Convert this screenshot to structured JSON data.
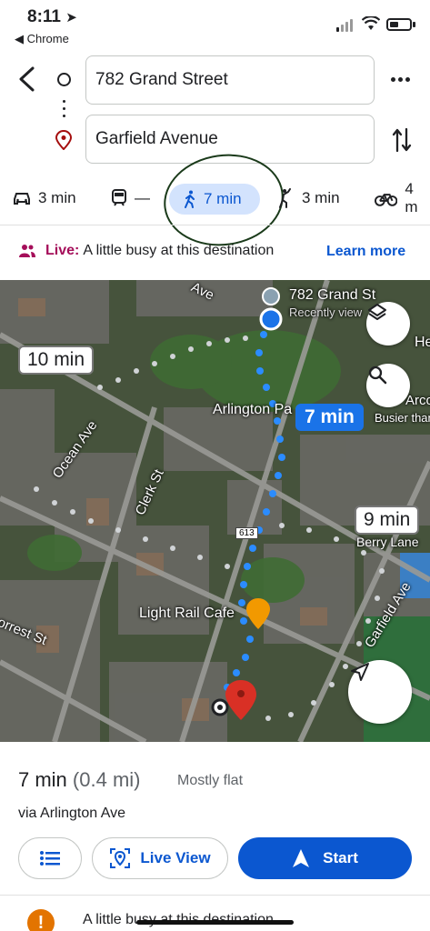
{
  "status_bar": {
    "time": "8:11",
    "back_app": "◀ Chrome"
  },
  "route": {
    "origin": "782 Grand Street",
    "destination": "Garfield Avenue"
  },
  "modes": [
    {
      "name": "car-icon",
      "label": "3 min"
    },
    {
      "name": "transit-icon",
      "label": "—"
    },
    {
      "name": "walk-icon",
      "label": "7 min",
      "selected": true
    },
    {
      "name": "rideshare-icon",
      "label": "3 min"
    },
    {
      "name": "bike-icon",
      "label": "4 m"
    }
  ],
  "live": {
    "label": "Live:",
    "text": "A little busy at this destination",
    "link": "Learn more"
  },
  "map": {
    "origin_label": "782 Grand St",
    "origin_sub": "Recently view",
    "park_label": "Arlington Pa",
    "busier_label": "Busier than",
    "partial_label": "He",
    "partial_label2": "Arco",
    "street_ave": "Ave",
    "ocean_ave": "Ocean Ave",
    "clerk_st": "Clerk St",
    "forrest_st": "orrest St",
    "garfield_ave": "Garfield Ave",
    "berry_lane": "Berry Lane",
    "cafe": "Light Rail Cafe",
    "route_badge": "613",
    "eta_alt1": "10 min",
    "eta_main": "7 min",
    "eta_alt2": "9 min",
    "accent": "#1a73e8"
  },
  "summary": {
    "time": "7 min",
    "distance": "(0.4 mi)",
    "note": "Mostly flat",
    "via": "via Arlington Ave"
  },
  "buttons": {
    "live_view": "Live View",
    "start": "Start"
  },
  "warning": {
    "text": "A little busy at this destination"
  }
}
